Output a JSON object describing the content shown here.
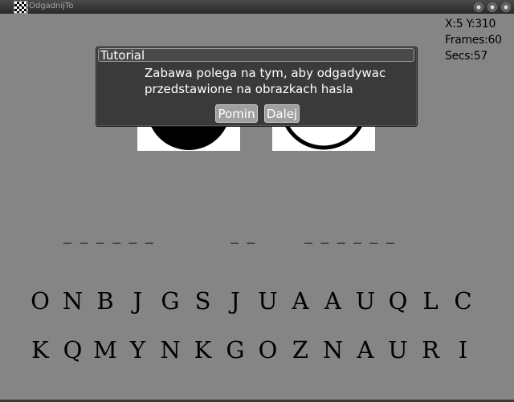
{
  "window": {
    "title": "OdgadnijTo"
  },
  "hud": {
    "coords": "X:5  Y:310",
    "frames": "Frames:60",
    "secs": "Secs:57"
  },
  "dialog": {
    "title": "Tutorial",
    "line1": "Zabawa polega na tym, aby odgadywac",
    "line2": "przedstawione na obrazkach hasla",
    "skip_label": "Pomin",
    "next_label": "Dalej"
  },
  "word_slots": {
    "word1": "_ _ _ _ _ _",
    "word2": "_ _",
    "word3": "_ _ _ _ _ _"
  },
  "letters": {
    "row1": [
      "O",
      "N",
      "B",
      "J",
      "G",
      "S",
      "J",
      "U",
      "A",
      "A",
      "U",
      "Q",
      "L",
      "C"
    ],
    "row2": [
      "K",
      "Q",
      "M",
      "Y",
      "N",
      "K",
      "G",
      "O",
      "Z",
      "N",
      "A",
      "U",
      "R",
      "I"
    ]
  },
  "colors": {
    "background": "#858585",
    "dialog": "#3a3a3a",
    "button": "#a0a0a0"
  }
}
